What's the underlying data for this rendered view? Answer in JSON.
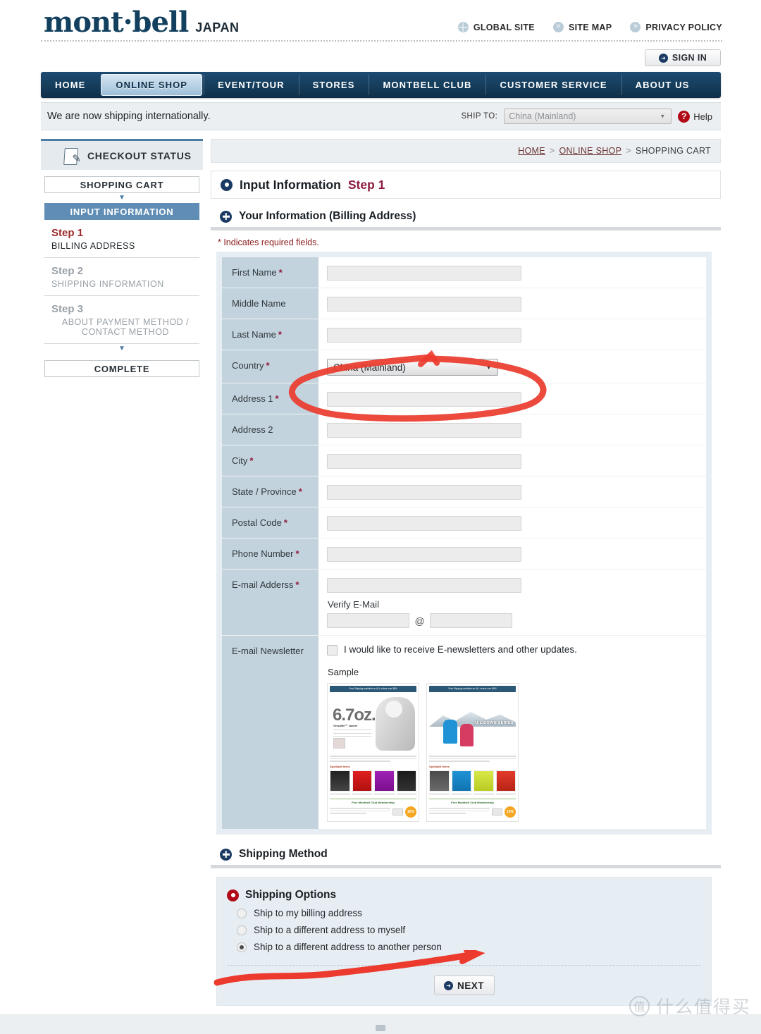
{
  "brand": {
    "logo_main": "mont·bell",
    "logo_sub": "JAPAN"
  },
  "top_links": [
    {
      "label": "GLOBAL SITE",
      "icon": "globe-icon"
    },
    {
      "label": "SITE MAP",
      "icon": "double-chevron-icon"
    },
    {
      "label": "PRIVACY POLICY",
      "icon": "double-chevron-icon"
    }
  ],
  "sign_in": {
    "label": "SIGN IN"
  },
  "nav": {
    "items": [
      {
        "label": "HOME",
        "active": false
      },
      {
        "label": "ONLINE SHOP",
        "active": true
      },
      {
        "label": "EVENT/TOUR",
        "active": false
      },
      {
        "label": "STORES",
        "active": false
      },
      {
        "label": "MONTBELL CLUB",
        "active": false
      },
      {
        "label": "CUSTOMER SERVICE",
        "active": false
      },
      {
        "label": "ABOUT US",
        "active": false
      }
    ]
  },
  "ship_bar": {
    "notice": "We are now shipping internationally.",
    "ship_to_label": "SHIP TO:",
    "ship_to_value": "China (Mainland)",
    "help_label": "Help",
    "help_icon": "question-mark-icon"
  },
  "sidebar": {
    "header": "CHECKOUT STATUS",
    "header_icon": "document-pencil-icon",
    "cart_label": "SHOPPING CART",
    "current_label": "INPUT INFORMATION",
    "steps": [
      {
        "num": "Step 1",
        "desc": "BILLING ADDRESS",
        "active": true
      },
      {
        "num": "Step 2",
        "desc": "SHIPPING INFORMATION",
        "active": false
      },
      {
        "num": "Step 3",
        "desc": "ABOUT PAYMENT METHOD / CONTACT METHOD",
        "active": false
      }
    ],
    "complete_label": "COMPLETE"
  },
  "breadcrumb": {
    "home": "HOME",
    "shop": "ONLINE SHOP",
    "current": "SHOPPING CART",
    "sep": ">"
  },
  "step_header": {
    "title": "Input Information",
    "step": "Step 1"
  },
  "section_billing": {
    "title": "Your Information (Billing Address)",
    "required_note": "* Indicates required fields."
  },
  "form": {
    "rows": [
      {
        "label": "First Name",
        "required": true,
        "type": "text"
      },
      {
        "label": "Middle Name",
        "required": false,
        "type": "text"
      },
      {
        "label": "Last Name",
        "required": true,
        "type": "text"
      },
      {
        "label": "Country",
        "required": true,
        "type": "select",
        "value": "China (Mainland)"
      },
      {
        "label": "Address 1",
        "required": true,
        "type": "text"
      },
      {
        "label": "Address 2",
        "required": false,
        "type": "text"
      },
      {
        "label": "City",
        "required": true,
        "type": "text"
      },
      {
        "label": "State / Province",
        "required": true,
        "type": "text"
      },
      {
        "label": "Postal Code",
        "required": true,
        "type": "text"
      },
      {
        "label": "Phone Number",
        "required": true,
        "type": "text"
      },
      {
        "label": "E-mail Adderss",
        "required": true,
        "type": "email"
      }
    ],
    "verify_email_label": "Verify E-Mail",
    "at_symbol": "@",
    "newsletter_label": "E-mail Newsletter",
    "newsletter_checkbox": "I would like to receive E-newsletters and other updates.",
    "newsletter_checked": false,
    "sample_label": "Sample",
    "samples": [
      {
        "banner": "Free Shipping available on ALL orders over $60!",
        "headline": "6.7oz.",
        "caption": "Versalite™ Jacket",
        "spotlight": "Spotlight Items",
        "club": "Free Montbell Club Membership",
        "badge": "10%"
      },
      {
        "banner": "Free Shipping available on ALL orders over $60!",
        "headline": "U.L.DOWN SERIES",
        "spotlight": "Spotlight Items",
        "club": "Free Montbell Club Membership",
        "badge": "10%"
      }
    ]
  },
  "section_shipping": {
    "title": "Shipping Method",
    "options_title": "Shipping Options",
    "options": [
      {
        "label": "Ship to my billing address",
        "selected": false
      },
      {
        "label": "Ship to a different address to myself",
        "selected": false
      },
      {
        "label": "Ship to a different address to another person",
        "selected": true
      }
    ],
    "next_label": "NEXT"
  },
  "annotations": {
    "circle": {
      "color": "#ec3b2e",
      "target": "country-select"
    },
    "underline": {
      "color": "#ec3b2e",
      "target": "ship-to-another-person-option"
    }
  },
  "watermark": {
    "mark": "值",
    "text": "什么值得买"
  },
  "colors": {
    "nav_dark": "#17405f",
    "accent_red": "#b00b16",
    "label_bg": "#c3d3dd",
    "annotation_red": "#ec3b2e"
  }
}
